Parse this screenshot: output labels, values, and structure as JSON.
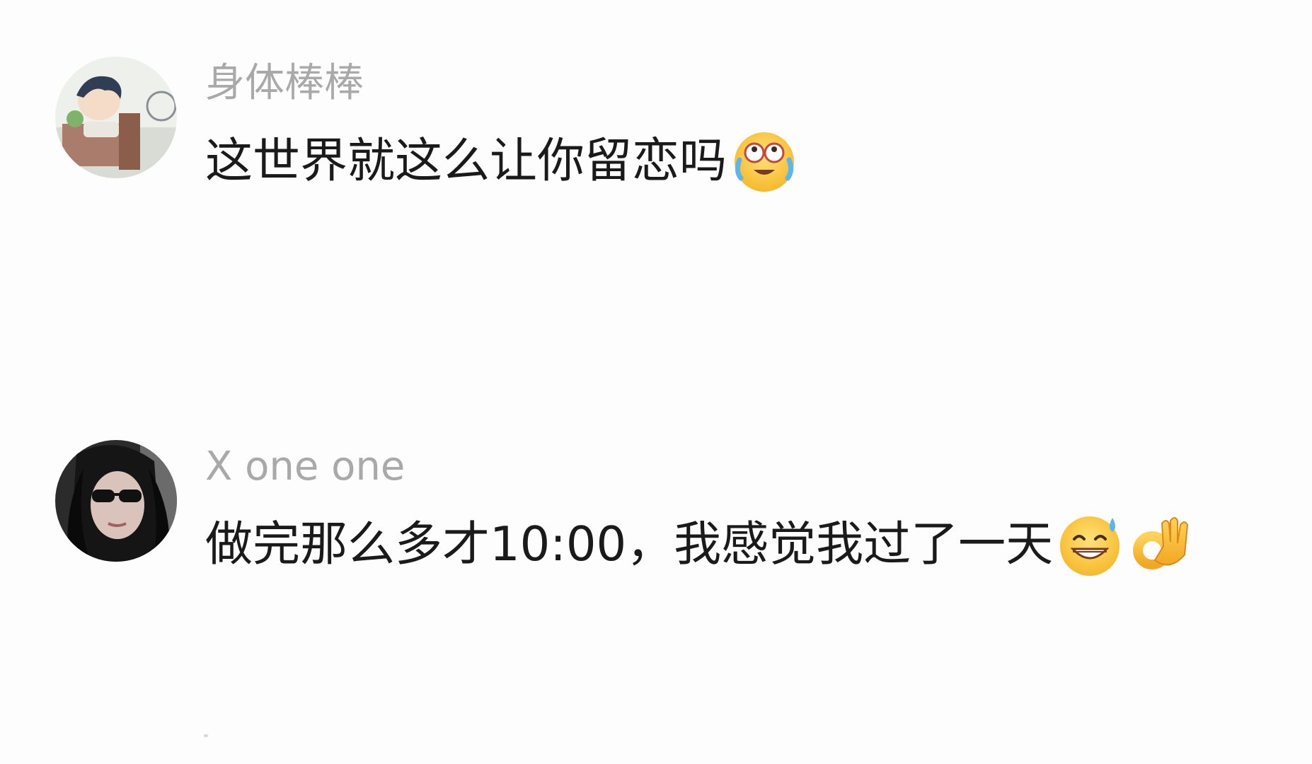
{
  "comments": [
    {
      "username": "身体棒棒",
      "text": "这世界就这么让你留恋吗",
      "emojis": [
        "laughing-crying-emoji"
      ]
    },
    {
      "username": "X one one",
      "text": "做完那么多才10:00，我感觉我过了一天",
      "emojis": [
        "sweat-grin-emoji",
        "ok-hand-emoji"
      ]
    }
  ],
  "colors": {
    "background": "#fdfdfd",
    "username": "#a9a9a9",
    "message": "#1a1a1a"
  }
}
